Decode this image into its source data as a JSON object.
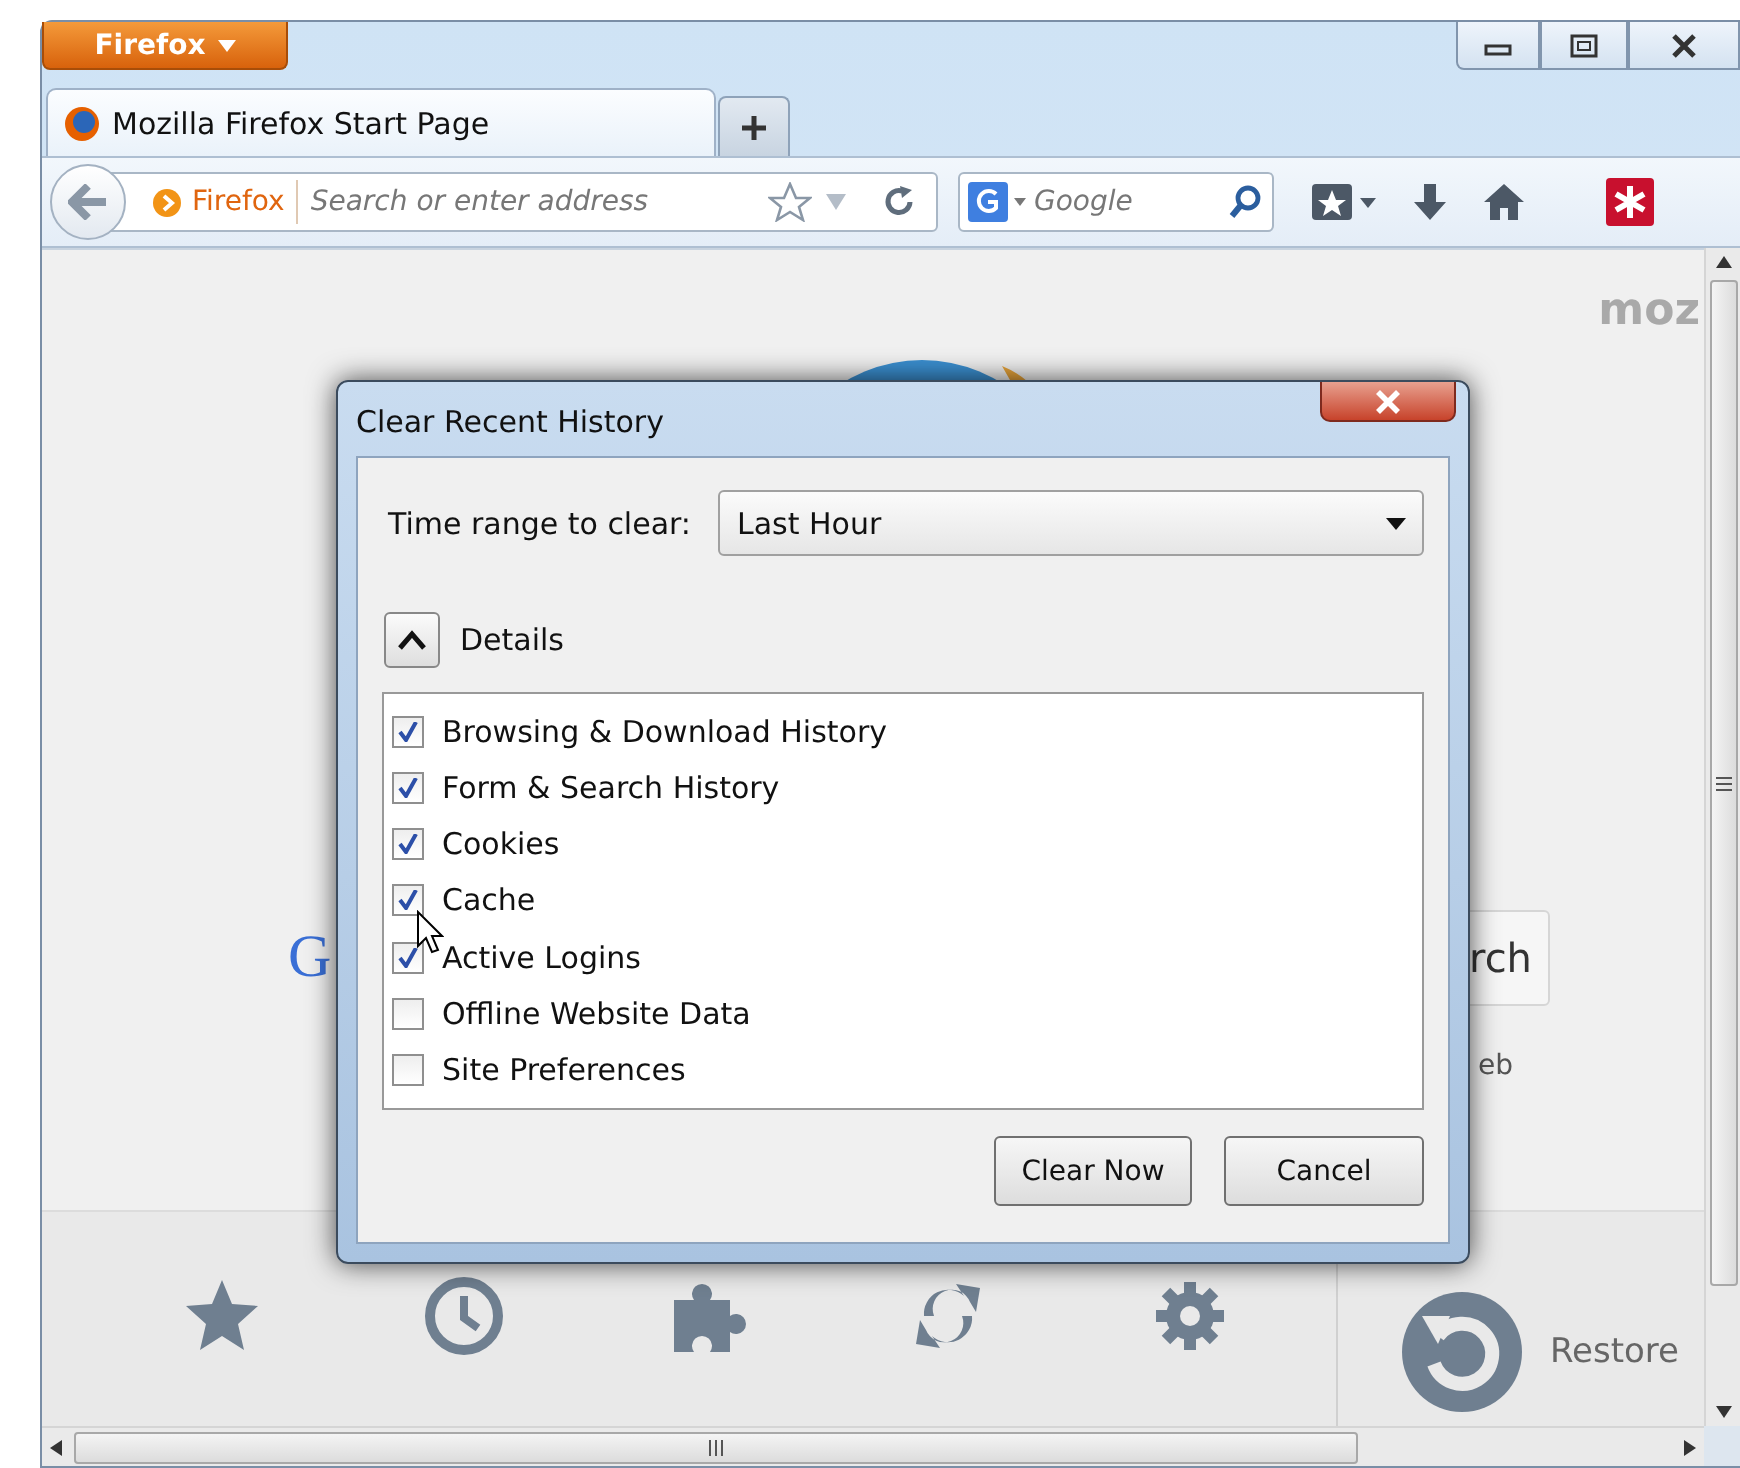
{
  "browser": {
    "menu_button": "Firefox",
    "tabs": [
      {
        "title": "Mozilla Firefox Start Page",
        "selected": true
      }
    ],
    "address": {
      "identity": "Firefox",
      "placeholder": "Search or enter address"
    },
    "search": {
      "placeholder": "Google"
    }
  },
  "page": {
    "logo_text": "moz",
    "google_letter": "G",
    "search_button": "rch",
    "link_text": "eb",
    "restore_label": "Restore"
  },
  "dialog": {
    "title": "Clear Recent History",
    "time_range_label": "Time range to clear:",
    "time_range_value": "Last Hour",
    "details_label": "Details",
    "details_expanded": true,
    "items": [
      {
        "label": "Browsing & Download History",
        "checked": true
      },
      {
        "label": "Form & Search History",
        "checked": true
      },
      {
        "label": "Cookies",
        "checked": true
      },
      {
        "label": "Cache",
        "checked": true
      },
      {
        "label": "Active Logins",
        "checked": true
      },
      {
        "label": "Offline Website Data",
        "checked": false
      },
      {
        "label": "Site Preferences",
        "checked": false
      }
    ],
    "buttons": [
      "Clear Now",
      "Cancel"
    ]
  }
}
